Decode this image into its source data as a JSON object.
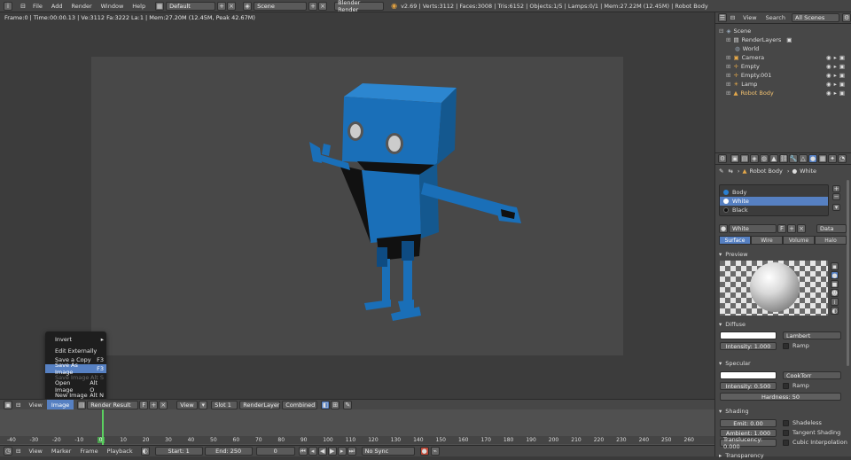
{
  "topbar": {
    "menus": [
      "File",
      "Add",
      "Render",
      "Window",
      "Help"
    ],
    "screen_layout": "Default",
    "scene": "Scene",
    "engine": "Blender Render",
    "stats": "v2.69 | Verts:3112 | Faces:3008 | Tris:6152 | Objects:1/5 | Lamps:0/1 | Mem:27.22M (12.45M) | Robot Body"
  },
  "viewport": {
    "info": "Frame:0 | Time:00:00.13 | Ve:3112 Fa:3222 La:1 | Mem:27.20M (12.45M, Peak 42.67M)"
  },
  "context_menu": {
    "items": [
      {
        "label": "Invert",
        "shortcut": "▸",
        "disabled": false,
        "highlight": false
      },
      {
        "label": "Edit Externally",
        "shortcut": "",
        "disabled": false,
        "highlight": false
      },
      {
        "label": "Save a Copy",
        "shortcut": "F3",
        "disabled": false,
        "highlight": false
      },
      {
        "label": "Save As Image",
        "shortcut": "F3",
        "disabled": false,
        "highlight": true
      },
      {
        "label": "Save Image",
        "shortcut": "Alt S",
        "disabled": true,
        "highlight": false
      },
      {
        "label": "Open Image",
        "shortcut": "Alt O",
        "disabled": false,
        "highlight": false
      },
      {
        "label": "New Image",
        "shortcut": "Alt N",
        "disabled": false,
        "highlight": false
      }
    ]
  },
  "image_header": {
    "view": "View",
    "image": "Image",
    "image_name": "Render Result",
    "f_label": "F",
    "view2": "View",
    "slot": "Slot 1",
    "layer": "RenderLayer",
    "pass": "Combined"
  },
  "timeline": {
    "ticks": [
      "-40",
      "-30",
      "-20",
      "-10",
      "0",
      "10",
      "20",
      "30",
      "40",
      "50",
      "60",
      "70",
      "80",
      "90",
      "100",
      "110",
      "120",
      "130",
      "140",
      "150",
      "160",
      "170",
      "180",
      "190",
      "200",
      "210",
      "220",
      "230",
      "240",
      "250",
      "260"
    ],
    "current_frame_marker": "0"
  },
  "tl_header": {
    "view": "View",
    "marker": "Marker",
    "frame": "Frame",
    "playback": "Playback",
    "start": "Start: 1",
    "end": "End: 250",
    "current": "0",
    "sync": "No Sync"
  },
  "outliner": {
    "view": "View",
    "search": "Search",
    "scenes": "All Scenes",
    "items": [
      {
        "label": "Scene",
        "indent": 0,
        "color": "#cccccc"
      },
      {
        "label": "RenderLayers",
        "indent": 1,
        "color": "#cccccc"
      },
      {
        "label": "World",
        "indent": 1,
        "color": "#cccccc"
      },
      {
        "label": "Camera",
        "indent": 1,
        "color": "#e4a84a"
      },
      {
        "label": "Empty",
        "indent": 1,
        "color": "#e4a84a"
      },
      {
        "label": "Empty.001",
        "indent": 1,
        "color": "#e4a84a"
      },
      {
        "label": "Lamp",
        "indent": 1,
        "color": "#e4a84a"
      },
      {
        "label": "Robot Body",
        "indent": 1,
        "color": "#e4a84a"
      }
    ]
  },
  "props": {
    "breadcrumb_object": "Robot Body",
    "breadcrumb_material": "White",
    "materials": [
      {
        "label": "Body",
        "color": "#2a7fd0",
        "active": false
      },
      {
        "label": "White",
        "color": "#ffffff",
        "active": true
      },
      {
        "label": "Black",
        "color": "#111111",
        "active": false
      }
    ],
    "material_name": "White",
    "f_label": "F",
    "data_label": "Data",
    "tabs": [
      "Surface",
      "Wire",
      "Volume",
      "Halo"
    ],
    "preview_label": "Preview",
    "diffuse_label": "Diffuse",
    "diffuse_shader": "Lambert",
    "diffuse_intensity": "Intensity: 1.000",
    "ramp": "Ramp",
    "specular_label": "Specular",
    "specular_shader": "CookTorr",
    "specular_intensity": "Intensity: 0.500",
    "hardness": "Hardness: 50",
    "shading_label": "Shading",
    "emit": "Emit: 0.00",
    "ambient": "Ambient: 1.000",
    "translucency": "Translucency: 0.000",
    "shadeless": "Shadeless",
    "tangent": "Tangent Shading",
    "cubic": "Cubic Interpolation",
    "transparency_label": "Transparency"
  },
  "colors": {
    "accent": "#5680c2",
    "robot": "#1a6fb8",
    "robot_dark": "#0e4b82"
  }
}
